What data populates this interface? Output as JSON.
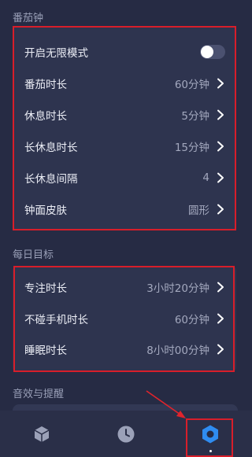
{
  "sections": {
    "pomodoro": {
      "title": "番茄钟",
      "toggle_row": {
        "label": "开启无限模式",
        "enabled": false
      },
      "rows": [
        {
          "label": "番茄时长",
          "value": "60分钟"
        },
        {
          "label": "休息时长",
          "value": "5分钟"
        },
        {
          "label": "长休息时长",
          "value": "15分钟"
        },
        {
          "label": "长休息间隔",
          "value": "4"
        },
        {
          "label": "钟面皮肤",
          "value": "圆形"
        }
      ]
    },
    "daily_goal": {
      "title": "每日目标",
      "rows": [
        {
          "label": "专注时长",
          "value": "3小时20分钟"
        },
        {
          "label": "不碰手机时长",
          "value": "60分钟"
        },
        {
          "label": "睡眠时长",
          "value": "8小时00分钟"
        }
      ]
    },
    "sound": {
      "title": "音效与提醒"
    }
  },
  "tabbar": {
    "tabs": [
      {
        "icon": "cube-icon",
        "active": false
      },
      {
        "icon": "clock-icon",
        "active": false
      },
      {
        "icon": "settings-hexagon-icon",
        "active": true
      }
    ]
  },
  "colors": {
    "background": "#262b44",
    "card": "#2e344f",
    "highlight_box": "#d81e2a",
    "accent_blue": "#2f8cf0"
  }
}
